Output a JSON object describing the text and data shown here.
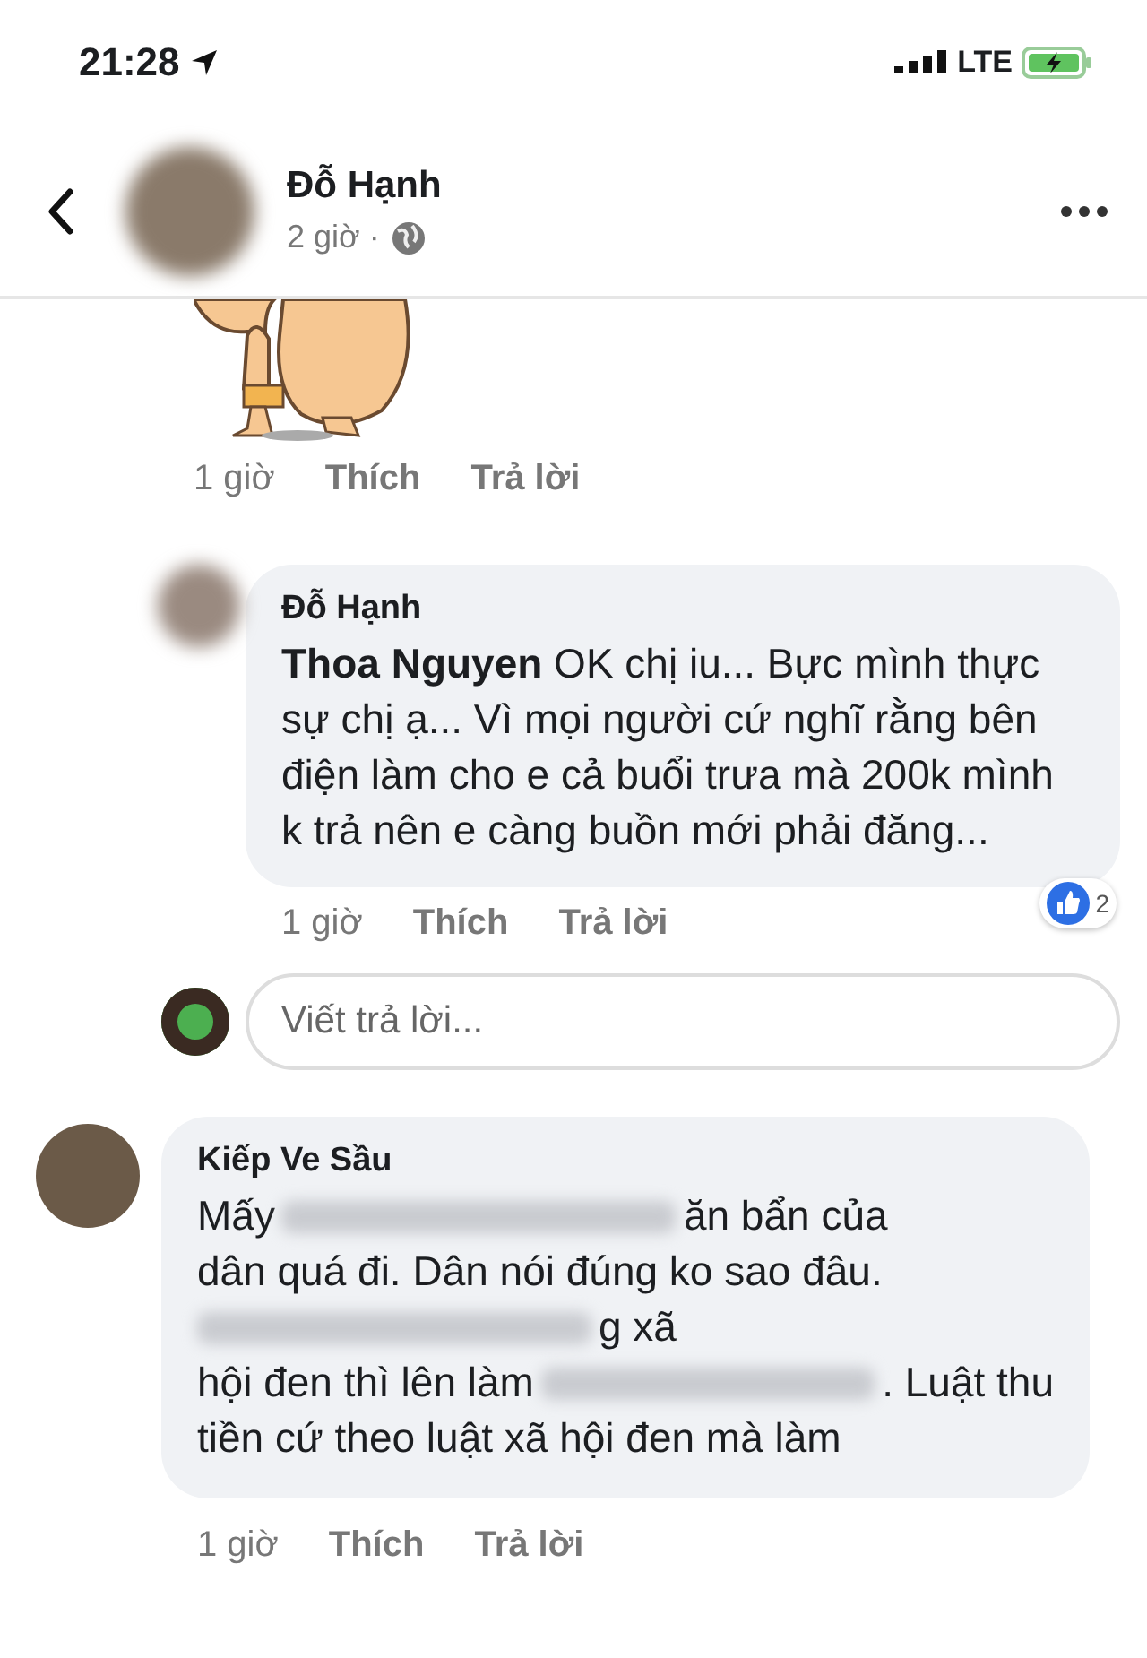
{
  "status_bar": {
    "time": "21:28",
    "network": "LTE"
  },
  "header": {
    "author": "Đỗ Hạnh",
    "time": "2 giờ ·"
  },
  "sticker_actions": {
    "time": "1 giờ",
    "like": "Thích",
    "reply": "Trả lời"
  },
  "reply": {
    "author": "Đỗ Hạnh",
    "text": "**Thoa Nguyen** OK chị iu... Bực mình thực sự chị ạ... Vì mọi người cứ nghĩ rằng bên điện làm cho e cả buổi trưa mà 200k mình k trả nên e càng buồn mới phải đăng...",
    "time": "1 giờ",
    "like": "Thích",
    "reply": "Trả lời",
    "reactions": "2"
  },
  "reply_field": {
    "placeholder": "Viết trả lời..."
  },
  "comment": {
    "author": "Kiếp Ve Sầu",
    "lines": [
      [
        {
          "kind": "text",
          "text": "Mấy"
        },
        {
          "kind": "blur"
        },
        {
          "kind": "text",
          "text": "ăn bẩn của"
        }
      ],
      [
        {
          "kind": "text",
          "text": "dân quá đi. Dân nói đúng ko sao đâu."
        }
      ],
      [
        {
          "kind": "blur"
        },
        {
          "kind": "text",
          "text": "g xã"
        }
      ],
      [
        {
          "kind": "text",
          "text": "hội đen thì lên làm"
        },
        {
          "kind": "blur"
        },
        {
          "kind": "text",
          "text": ". Luật thu"
        }
      ],
      [
        {
          "kind": "text",
          "text": "tiền cứ theo luật xã hội đen mà làm"
        }
      ]
    ],
    "time": "1 giờ",
    "like": "Thích",
    "reply": "Trả lời"
  }
}
